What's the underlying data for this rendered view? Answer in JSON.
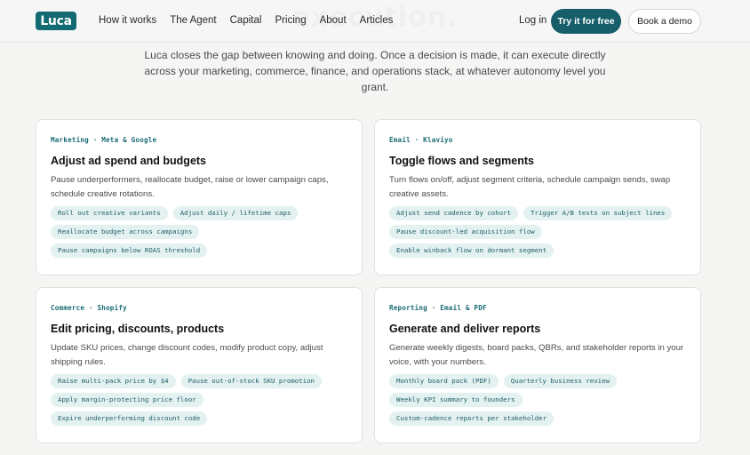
{
  "hero": {
    "ghost_heading": "execution."
  },
  "nav": {
    "logo": "Luca",
    "links": [
      "How it works",
      "The Agent",
      "Capital",
      "Pricing",
      "About",
      "Articles"
    ],
    "login": "Log in",
    "primary_cta": "Try it for free",
    "secondary_cta": "Book a demo"
  },
  "intro": "Luca closes the gap between knowing and doing. Once a decision is made, it can execute directly across your marketing, commerce, finance, and operations stack, at whatever autonomy level you grant.",
  "cards": [
    {
      "eyebrow": "Marketing · Meta & Google",
      "title": "Adjust ad spend and budgets",
      "description": "Pause underperformers, reallocate budget, raise or lower campaign caps, schedule creative rotations.",
      "tags": [
        "Roll out creative variants",
        "Adjust daily / lifetime caps",
        "Reallocate budget across campaigns",
        "Pause campaigns below ROAS threshold"
      ]
    },
    {
      "eyebrow": "Email · Klaviyo",
      "title": "Toggle flows and segments",
      "description": "Turn flows on/off, adjust segment criteria, schedule campaign sends, swap creative assets.",
      "tags": [
        "Adjust send cadence by cohort",
        "Trigger A/B tests on subject lines",
        "Pause discount-led acquisition flow",
        "Enable winback flow on dormant segment"
      ]
    },
    {
      "eyebrow": "Commerce · Shopify",
      "title": "Edit pricing, discounts, products",
      "description": "Update SKU prices, change discount codes, modify product copy, adjust shipping rules.",
      "tags": [
        "Raise multi-pack price by $4",
        "Pause out-of-stock SKU promotion",
        "Apply margin-protecting price floor",
        "Expire underperforming discount code"
      ]
    },
    {
      "eyebrow": "Reporting · Email & PDF",
      "title": "Generate and deliver reports",
      "description": "Generate weekly digests, board packs, QBRs, and stakeholder reports in your voice, with your numbers.",
      "tags": [
        "Monthly board pack (PDF)",
        "Quarterly business review",
        "Weekly KPI summary to founders",
        "Custom-cadence reports per stakeholder"
      ]
    }
  ]
}
